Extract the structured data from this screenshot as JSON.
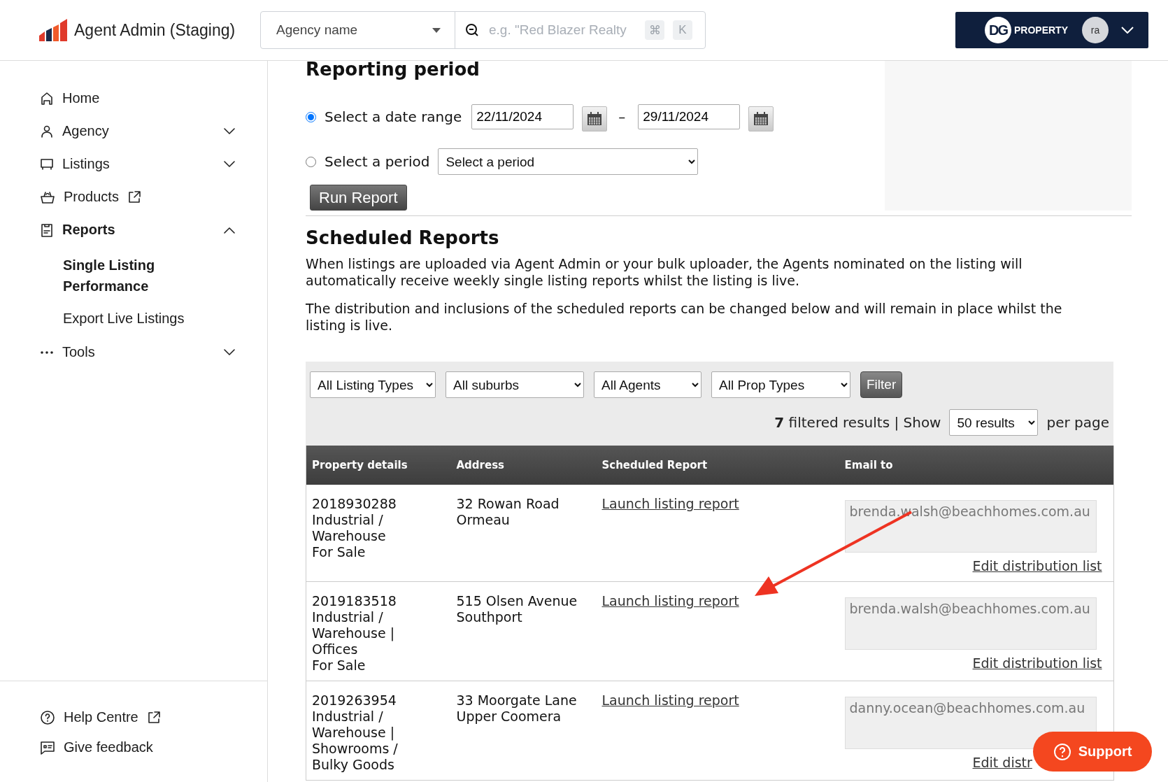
{
  "header": {
    "app_title": "Agent Admin (Staging)",
    "agency_select": {
      "value": "Agency name"
    },
    "search": {
      "placeholder": "e.g. \"Red Blazer Realty",
      "shortcut_keys": [
        "⌘",
        "K"
      ]
    },
    "account": {
      "brand_mark": "DG",
      "brand_name": "PROPERTY",
      "avatar": "ra"
    }
  },
  "sidebar": {
    "items": [
      {
        "kind": "link",
        "label": "Home",
        "selected": false,
        "external": false
      },
      {
        "kind": "group",
        "label": "Agency",
        "selected": false,
        "external": false,
        "expanded": false
      },
      {
        "kind": "group",
        "label": "Listings",
        "selected": false,
        "external": false,
        "expanded": false
      },
      {
        "kind": "link",
        "label": "Products",
        "selected": false,
        "external": true
      },
      {
        "kind": "group",
        "label": "Reports",
        "selected": true,
        "external": false,
        "expanded": true,
        "children": [
          {
            "label": "Single Listing Performance",
            "selected": true
          },
          {
            "label": "Export Live Listings",
            "selected": false
          }
        ]
      },
      {
        "kind": "group",
        "label": "Tools",
        "selected": false,
        "external": false,
        "expanded": false
      }
    ],
    "footer_items": [
      {
        "label": "Help Centre",
        "external": true
      },
      {
        "label": "Give feedback",
        "external": false
      }
    ]
  },
  "reporting_period": {
    "title": "Reporting period",
    "options": [
      {
        "kind": "date_range",
        "label": "Select a date range",
        "selected": true,
        "from": "22/11/2024",
        "separator": "–",
        "to": "29/11/2024"
      },
      {
        "kind": "period",
        "label": "Select a period",
        "selected": false,
        "value": "Select a period"
      }
    ],
    "run_button": "Run Report"
  },
  "scheduled_reports": {
    "title": "Scheduled Reports",
    "paragraphs": [
      "When listings are uploaded via Agent Admin or your bulk uploader, the Agents nominated on the listing will automatically receive weekly single listing reports whilst the listing is live.",
      "The distribution and inclusions of the scheduled reports can be changed below and will remain in place whilst the listing is live."
    ],
    "filters": [
      "All Listing Types",
      "All suburbs",
      "All Agents",
      "All Prop Types"
    ],
    "filter_button": "Filter",
    "results_summary": "**7** filtered results | Show",
    "per_page_select": "50 results",
    "per_page_suffix": "per page",
    "table": {
      "columns": [
        "Property details",
        "Address",
        "Scheduled Report",
        "Email to"
      ],
      "rows": [
        {
          "details": [
            "2018930288",
            "Industrial /",
            "Warehouse",
            "For Sale"
          ],
          "address": [
            "32 Rowan Road",
            "Ormeau"
          ],
          "report_link": "Launch listing report",
          "email": "brenda.walsh@beachhomes.com.au",
          "edit_link": "Edit distribution list"
        },
        {
          "details": [
            "2019183518",
            "Industrial /",
            "Warehouse |",
            "Offices",
            "For Sale"
          ],
          "address": [
            "515 Olsen Avenue",
            "Southport"
          ],
          "report_link": "Launch listing report",
          "email": "brenda.walsh@beachhomes.com.au",
          "edit_link": "Edit distribution list"
        },
        {
          "details": [
            "2019263954",
            "Industrial /",
            "Warehouse |",
            "Showrooms /",
            "Bulky Goods"
          ],
          "address": [
            "33 Moorgate Lane",
            "Upper Coomera"
          ],
          "report_link": "Launch listing report",
          "email": "danny.ocean@beachhomes.com.au",
          "edit_link": "Edit distr"
        }
      ]
    }
  },
  "support_button": "Support"
}
